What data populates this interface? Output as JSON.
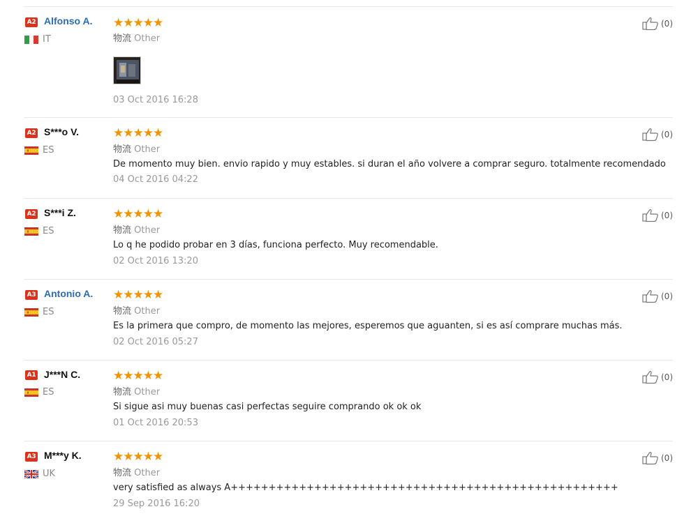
{
  "reviews": [
    {
      "badge": "A2",
      "name": "Alfonso A.",
      "name_is_link": true,
      "country": "IT",
      "rating": 5,
      "stars": "★★★★★",
      "logistics_label": "物流",
      "logistics_value": "Other",
      "comment": "",
      "has_photo": true,
      "date": "03 Oct 2016 16:28",
      "helpful": "(0)"
    },
    {
      "badge": "A2",
      "name": "S***o V.",
      "name_is_link": false,
      "country": "ES",
      "rating": 5,
      "stars": "★★★★★",
      "logistics_label": "物流",
      "logistics_value": "Other",
      "comment": "De momento muy bien. envio rapido y muy estables. si duran el año volvere a comprar seguro. totalmente recomendado",
      "has_photo": false,
      "date": "04 Oct 2016 04:22",
      "helpful": "(0)"
    },
    {
      "badge": "A2",
      "name": "S***i Z.",
      "name_is_link": false,
      "country": "ES",
      "rating": 5,
      "stars": "★★★★★",
      "logistics_label": "物流",
      "logistics_value": "Other",
      "comment": "Lo q he podido probar en 3 días, funciona perfecto. Muy recomendable.",
      "has_photo": false,
      "date": "02 Oct 2016 13:20",
      "helpful": "(0)"
    },
    {
      "badge": "A3",
      "name": "Antonio A.",
      "name_is_link": true,
      "country": "ES",
      "rating": 5,
      "stars": "★★★★★",
      "logistics_label": "物流",
      "logistics_value": "Other",
      "comment": "Es la primera que compro, de momento las mejores, esperemos que aguanten, si es así comprare muchas más.",
      "has_photo": false,
      "date": "02 Oct 2016 05:27",
      "helpful": "(0)"
    },
    {
      "badge": "A1",
      "name": "J***N C.",
      "name_is_link": false,
      "country": "ES",
      "rating": 5,
      "stars": "★★★★★",
      "logistics_label": "物流",
      "logistics_value": "Other",
      "comment": "Si sigue asi muy buenas casi perfectas seguire comprando ok ok ok",
      "has_photo": false,
      "date": "01 Oct 2016 20:53",
      "helpful": "(0)"
    },
    {
      "badge": "A3",
      "name": "M***y K.",
      "name_is_link": false,
      "country": "UK",
      "rating": 5,
      "stars": "★★★★★",
      "logistics_label": "物流",
      "logistics_value": "Other",
      "comment": "very satisfied as always A+++++++++++++++++++++++++++++++++++++++++++++++++++",
      "has_photo": false,
      "date": "29 Sep 2016 16:20",
      "helpful": "(0)"
    }
  ],
  "colors": {
    "star": "#f29300",
    "badge": "#d9331c",
    "link_name": "#2b6cb5",
    "muted": "#999999"
  },
  "icons": {
    "helpful": "thumbs-up-icon",
    "flag_it": "italy-flag-icon",
    "flag_es": "spain-flag-icon",
    "flag_uk": "uk-flag-icon"
  }
}
